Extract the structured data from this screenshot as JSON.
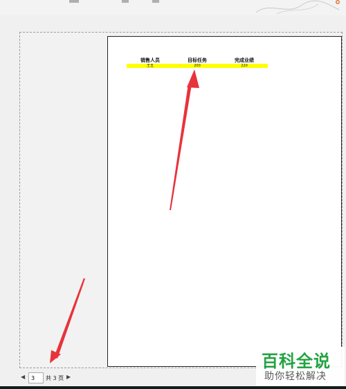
{
  "table": {
    "headers": [
      "销售人员",
      "目标任务",
      "完成业绩"
    ],
    "row": [
      "王五",
      "200",
      "220"
    ]
  },
  "pager": {
    "current_page": "3",
    "total_label": "共 3 页",
    "prev_icon": "triangle-left-icon",
    "next_icon": "triangle-right-icon"
  },
  "watermark": {
    "title": "百科全说",
    "subtitle": "助你轻松解决"
  },
  "colors": {
    "highlight": "#ffff00",
    "arrow": "#e8333a",
    "watermark_green": "#1aa03a"
  }
}
